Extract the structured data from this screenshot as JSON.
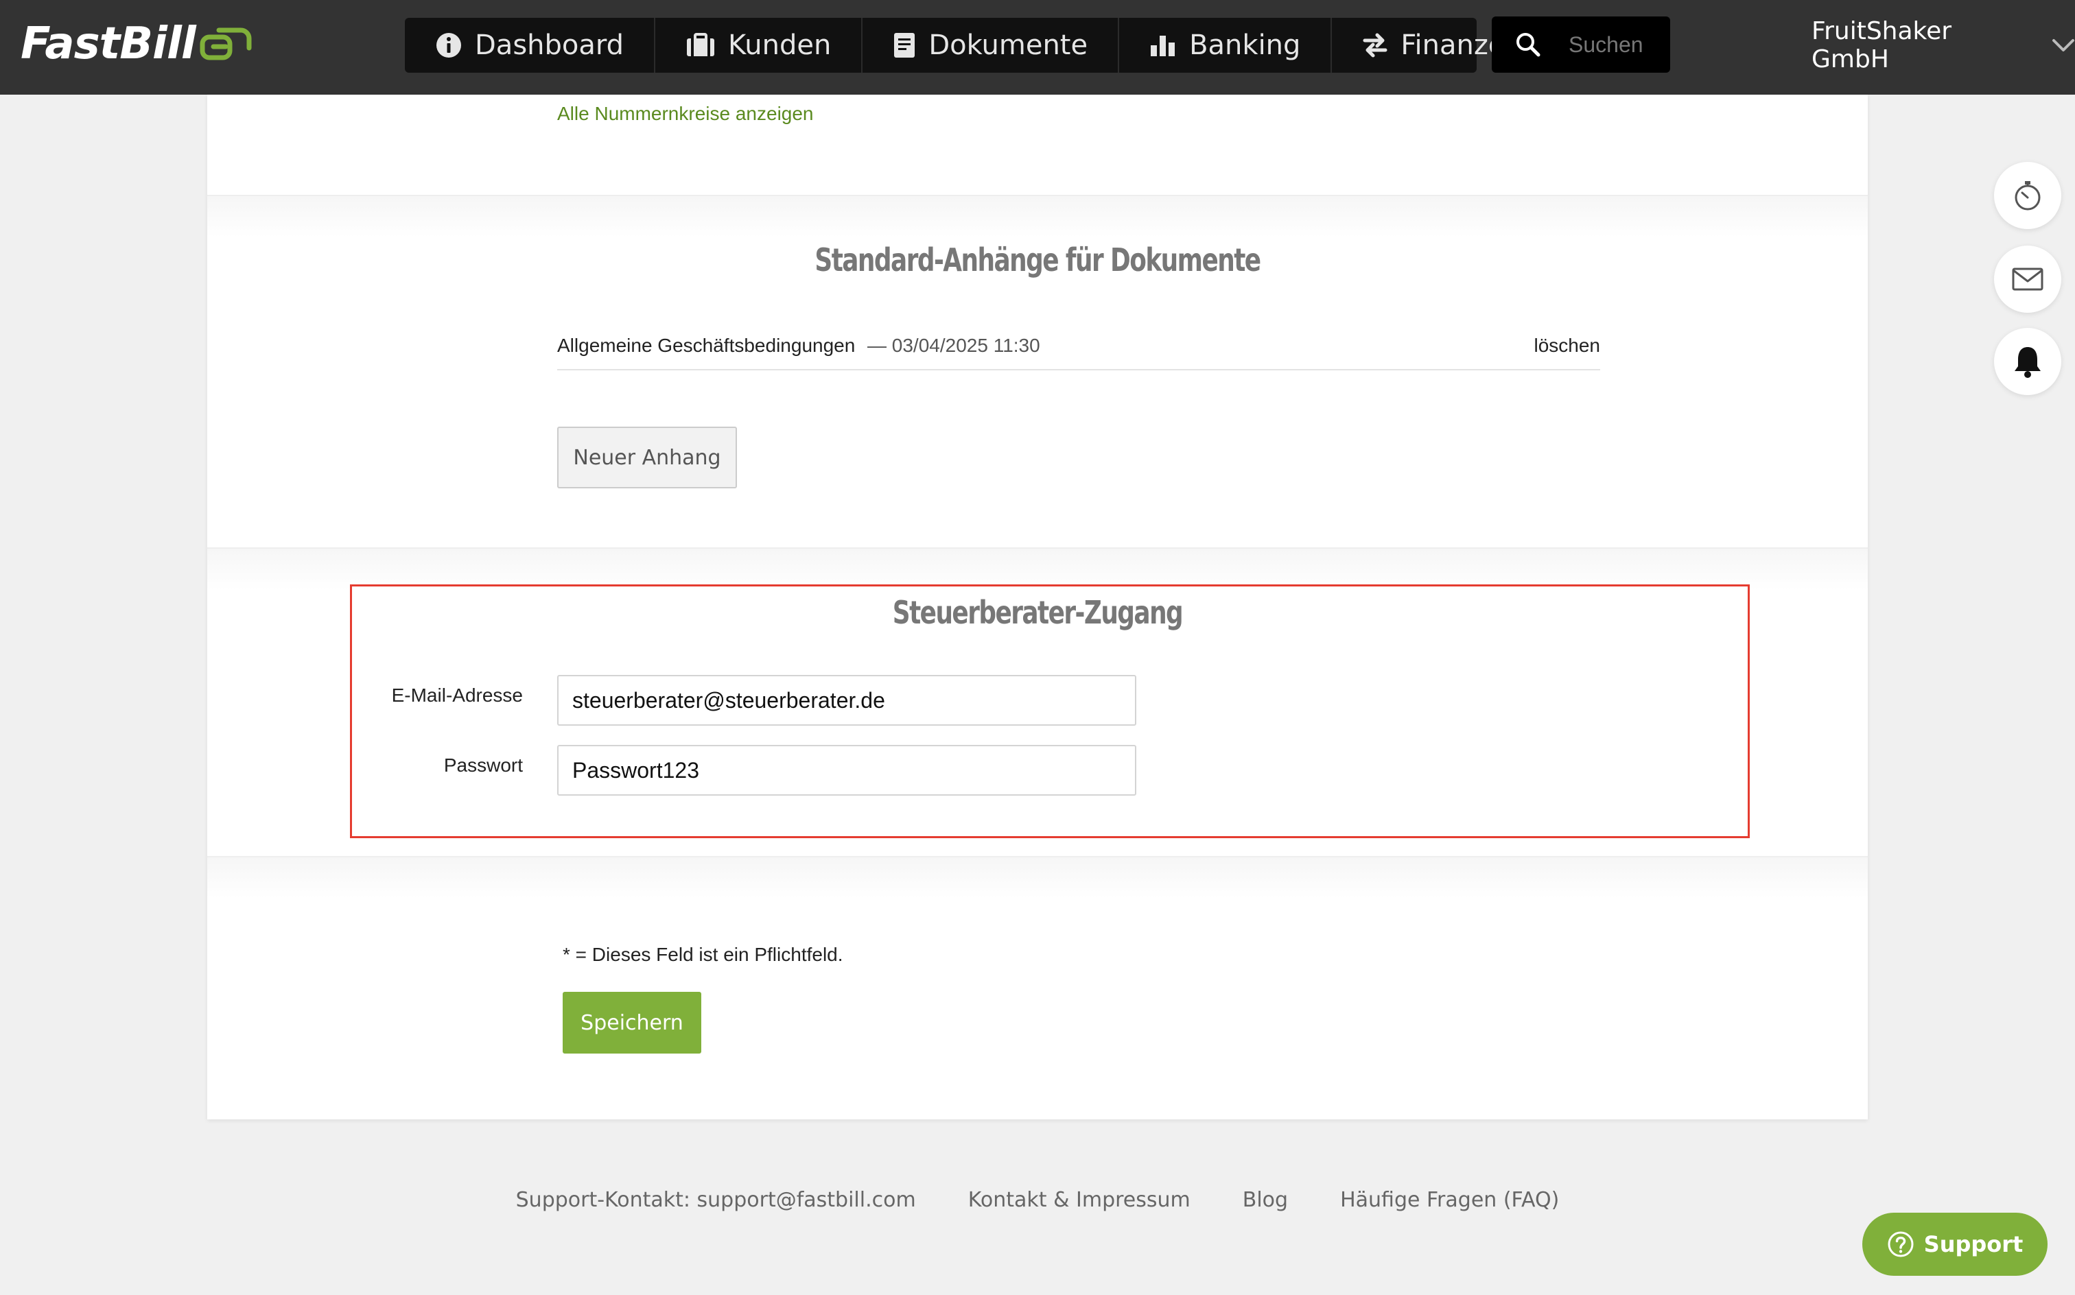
{
  "brand": {
    "name": "FastBill",
    "accent_color": "#80b03a",
    "link_color": "#5a8a1f",
    "highlight_color": "#e53c30"
  },
  "nav": {
    "items": [
      {
        "label": "Dashboard",
        "icon": "info-icon"
      },
      {
        "label": "Kunden",
        "icon": "briefcase-icon"
      },
      {
        "label": "Dokumente",
        "icon": "document-icon"
      },
      {
        "label": "Banking",
        "icon": "bar-chart-icon"
      },
      {
        "label": "Finanzen",
        "icon": "transfer-arrows-icon"
      }
    ],
    "search_placeholder": "Suchen",
    "company": "FruitShaker GmbH"
  },
  "top_section": {
    "link": "Alle Nummernkreise anzeigen"
  },
  "attachments": {
    "title": "Standard-Anhänge für Dokumente",
    "rows": [
      {
        "name": "Allgemeine Geschäftsbedingungen",
        "date": "— 03/04/2025 11:30",
        "action": "löschen"
      }
    ],
    "new_button": "Neuer Anhang"
  },
  "tax_advisor": {
    "title": "Steuerberater-Zugang",
    "email_label": "E-Mail-Adresse",
    "email_value": "steuerberater@steuerberater.de",
    "password_label": "Passwort",
    "password_value": "Passwort123"
  },
  "form_footer": {
    "required_note": "* = Dieses Feld ist ein Pflichtfeld.",
    "save_button": "Speichern"
  },
  "footer": {
    "links": [
      "Support-Kontakt: support@fastbill.com",
      "Kontakt & Impressum",
      "Blog",
      "Häufige Fragen (FAQ)"
    ]
  },
  "side_actions": [
    "stopwatch-icon",
    "mail-icon",
    "bell-icon"
  ],
  "support": {
    "label": "Support",
    "icon": "question-circle-icon"
  }
}
